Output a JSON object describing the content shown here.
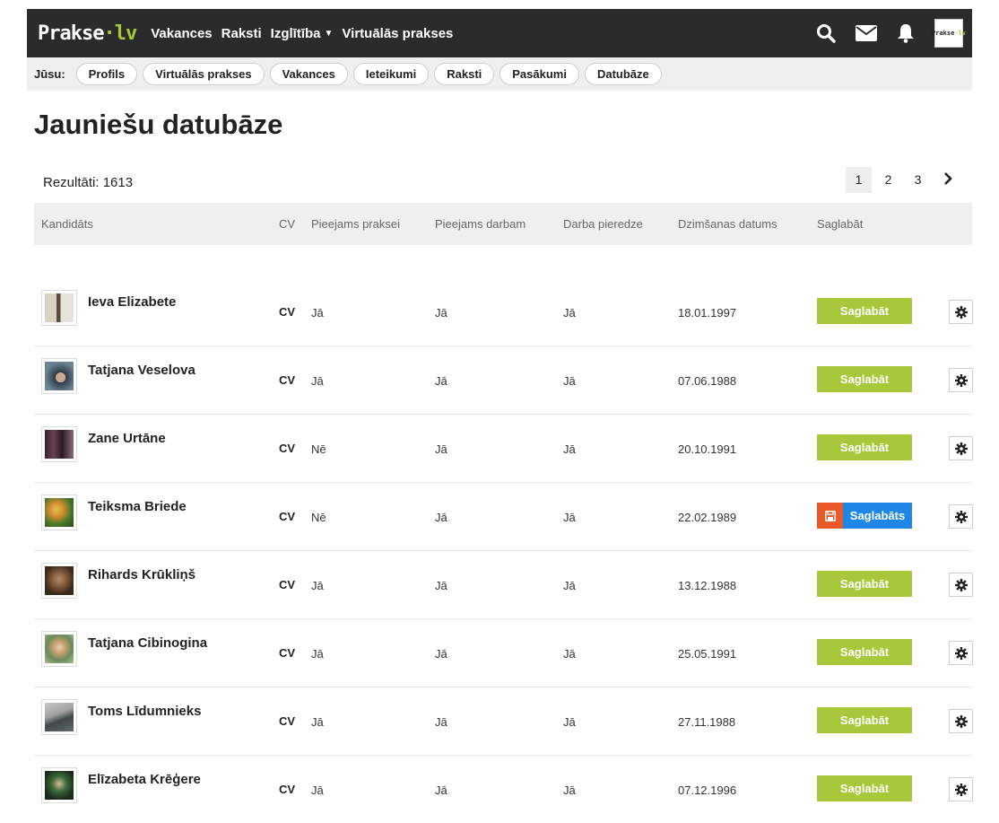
{
  "header": {
    "logo_main": "Prakse",
    "logo_tld": "lv",
    "nav": [
      "Vakances",
      "Raksti",
      "Izglītība",
      "Virtuālās prakses"
    ],
    "icons": [
      "search-icon",
      "mail-icon",
      "bell-icon"
    ],
    "avatar_main": "Prakse",
    "avatar_tld": "lv"
  },
  "subnav": {
    "label": "Jūsu:",
    "items": [
      "Profils",
      "Virtuālās prakses",
      "Vakances",
      "Ieteikumi",
      "Raksti",
      "Pasākumi",
      "Datubāze"
    ]
  },
  "page": {
    "title": "Jauniešu datubāze",
    "results": "Rezultāti: 1613"
  },
  "pagination": {
    "pages": [
      "1",
      "2",
      "3"
    ],
    "current": "1",
    "next": "›"
  },
  "table": {
    "headers": {
      "candidate": "Kandidāts",
      "cv": "CV",
      "internship": "Pieejams praksei",
      "work": "Pieejams darbam",
      "experience": "Darba pieredze",
      "birth": "Dzimšanas datums",
      "save": "Saglabāt"
    },
    "save_label": "Saglabāt",
    "saved_label": "Saglabāts",
    "rows": [
      {
        "name": "Ieva Elizabete",
        "cv": "CV",
        "internship": "Jā",
        "work": "Jā",
        "experience": "Jā",
        "birth": "18.01.1997",
        "saved": false
      },
      {
        "name": "Tatjana Veselova",
        "cv": "CV",
        "internship": "Jā",
        "work": "Jā",
        "experience": "Jā",
        "birth": "07.06.1988",
        "saved": false
      },
      {
        "name": "Zane Urtāne",
        "cv": "CV",
        "internship": "Nē",
        "work": "Jā",
        "experience": "Jā",
        "birth": "20.10.1991",
        "saved": false
      },
      {
        "name": "Teiksma Briede",
        "cv": "CV",
        "internship": "Nē",
        "work": "Jā",
        "experience": "Jā",
        "birth": "22.02.1989",
        "saved": true
      },
      {
        "name": "Rihards Krūkliņš",
        "cv": "CV",
        "internship": "Jā",
        "work": "Jā",
        "experience": "Jā",
        "birth": "13.12.1988",
        "saved": false
      },
      {
        "name": "Tatjana Cibinogina",
        "cv": "CV",
        "internship": "Jā",
        "work": "Jā",
        "experience": "Jā",
        "birth": "25.05.1991",
        "saved": false
      },
      {
        "name": "Toms Līdumnieks",
        "cv": "CV",
        "internship": "Jā",
        "work": "Jā",
        "experience": "Jā",
        "birth": "27.11.1988",
        "saved": false
      },
      {
        "name": "Elīzabeta Krēģere",
        "cv": "CV",
        "internship": "Jā",
        "work": "Jā",
        "experience": "Jā",
        "birth": "07.12.1996",
        "saved": false
      }
    ]
  },
  "colors": {
    "topbar": "#2b2b2b",
    "accent_green": "#a6c83a",
    "saved_blue": "#1e87e5",
    "delete_orange": "#e95a28"
  }
}
